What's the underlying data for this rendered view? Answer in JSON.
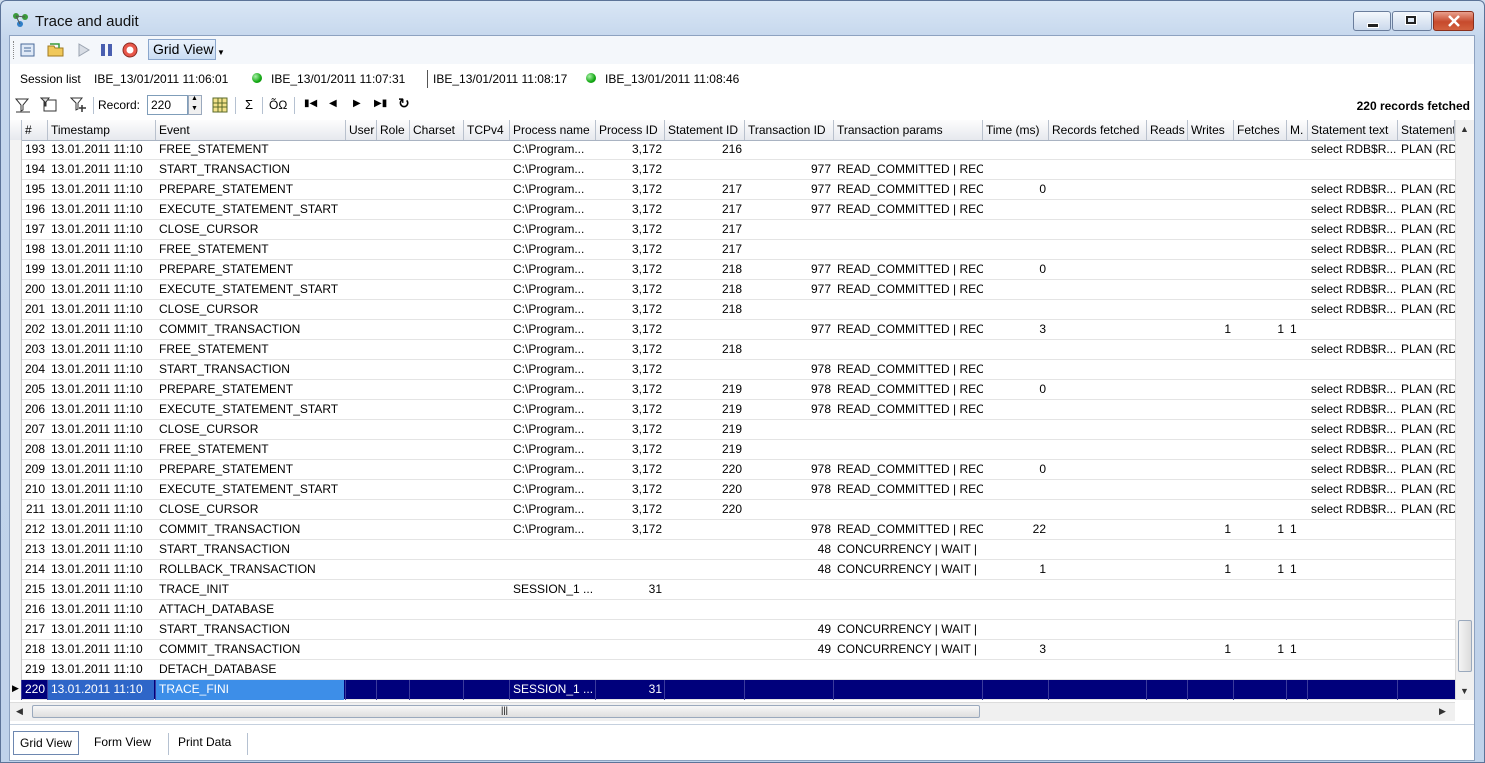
{
  "window": {
    "title": "Trace and audit"
  },
  "toolbar": {
    "view_label": "Grid View"
  },
  "session_bar": {
    "label": "Session list",
    "sessions": [
      "IBE_13/01/2011 11:06:01",
      "IBE_13/01/2011 11:07:31",
      "IBE_13/01/2011 11:08:17",
      "IBE_13/01/2011 11:08:46"
    ]
  },
  "nav": {
    "record_label": "Record:",
    "record_value": "220",
    "fetched": "220 records fetched",
    "sigma": "Σ",
    "oomega": "ÕΩ"
  },
  "grid": {
    "columns": [
      "#",
      "Timestamp",
      "Event",
      "User",
      "Role",
      "Charset",
      "TCPv4",
      "Process name",
      "Process ID",
      "Statement ID",
      "Transaction ID",
      "Transaction params",
      "Time (ms)",
      "Records fetched",
      "Reads",
      "Writes",
      "Fetches",
      "M.",
      "Statement text",
      "Statement"
    ],
    "rows": [
      [
        "193",
        "13.01.2011 11:10",
        "FREE_STATEMENT",
        "",
        "",
        "",
        "",
        "C:\\Program...",
        "3,172",
        "216",
        "",
        "",
        "",
        "",
        "",
        "",
        "",
        "",
        "select RDB$R...",
        "PLAN (RD"
      ],
      [
        "194",
        "13.01.2011 11:10",
        "START_TRANSACTION",
        "",
        "",
        "",
        "",
        "C:\\Program...",
        "3,172",
        "",
        "977",
        "READ_COMMITTED | REC",
        "",
        "",
        "",
        "",
        "",
        "",
        "",
        ""
      ],
      [
        "195",
        "13.01.2011 11:10",
        "PREPARE_STATEMENT",
        "",
        "",
        "",
        "",
        "C:\\Program...",
        "3,172",
        "217",
        "977",
        "READ_COMMITTED | REC",
        "0",
        "",
        "",
        "",
        "",
        "",
        "select RDB$R...",
        "PLAN (RD"
      ],
      [
        "196",
        "13.01.2011 11:10",
        "EXECUTE_STATEMENT_START",
        "",
        "",
        "",
        "",
        "C:\\Program...",
        "3,172",
        "217",
        "977",
        "READ_COMMITTED | REC",
        "",
        "",
        "",
        "",
        "",
        "",
        "select RDB$R...",
        "PLAN (RD"
      ],
      [
        "197",
        "13.01.2011 11:10",
        "CLOSE_CURSOR",
        "",
        "",
        "",
        "",
        "C:\\Program...",
        "3,172",
        "217",
        "",
        "",
        "",
        "",
        "",
        "",
        "",
        "",
        "select RDB$R...",
        "PLAN (RD"
      ],
      [
        "198",
        "13.01.2011 11:10",
        "FREE_STATEMENT",
        "",
        "",
        "",
        "",
        "C:\\Program...",
        "3,172",
        "217",
        "",
        "",
        "",
        "",
        "",
        "",
        "",
        "",
        "select RDB$R...",
        "PLAN (RD"
      ],
      [
        "199",
        "13.01.2011 11:10",
        "PREPARE_STATEMENT",
        "",
        "",
        "",
        "",
        "C:\\Program...",
        "3,172",
        "218",
        "977",
        "READ_COMMITTED | REC",
        "0",
        "",
        "",
        "",
        "",
        "",
        "select RDB$R...",
        "PLAN (RD"
      ],
      [
        "200",
        "13.01.2011 11:10",
        "EXECUTE_STATEMENT_START",
        "",
        "",
        "",
        "",
        "C:\\Program...",
        "3,172",
        "218",
        "977",
        "READ_COMMITTED | REC",
        "",
        "",
        "",
        "",
        "",
        "",
        "select RDB$R...",
        "PLAN (RD"
      ],
      [
        "201",
        "13.01.2011 11:10",
        "CLOSE_CURSOR",
        "",
        "",
        "",
        "",
        "C:\\Program...",
        "3,172",
        "218",
        "",
        "",
        "",
        "",
        "",
        "",
        "",
        "",
        "select RDB$R...",
        "PLAN (RD"
      ],
      [
        "202",
        "13.01.2011 11:10",
        "COMMIT_TRANSACTION",
        "",
        "",
        "",
        "",
        "C:\\Program...",
        "3,172",
        "",
        "977",
        "READ_COMMITTED | REC",
        "3",
        "",
        "",
        "1",
        "1",
        "1",
        "",
        ""
      ],
      [
        "203",
        "13.01.2011 11:10",
        "FREE_STATEMENT",
        "",
        "",
        "",
        "",
        "C:\\Program...",
        "3,172",
        "218",
        "",
        "",
        "",
        "",
        "",
        "",
        "",
        "",
        "select RDB$R...",
        "PLAN (RD"
      ],
      [
        "204",
        "13.01.2011 11:10",
        "START_TRANSACTION",
        "",
        "",
        "",
        "",
        "C:\\Program...",
        "3,172",
        "",
        "978",
        "READ_COMMITTED | REC",
        "",
        "",
        "",
        "",
        "",
        "",
        "",
        ""
      ],
      [
        "205",
        "13.01.2011 11:10",
        "PREPARE_STATEMENT",
        "",
        "",
        "",
        "",
        "C:\\Program...",
        "3,172",
        "219",
        "978",
        "READ_COMMITTED | REC",
        "0",
        "",
        "",
        "",
        "",
        "",
        "select RDB$R...",
        "PLAN (RD"
      ],
      [
        "206",
        "13.01.2011 11:10",
        "EXECUTE_STATEMENT_START",
        "",
        "",
        "",
        "",
        "C:\\Program...",
        "3,172",
        "219",
        "978",
        "READ_COMMITTED | REC",
        "",
        "",
        "",
        "",
        "",
        "",
        "select RDB$R...",
        "PLAN (RD"
      ],
      [
        "207",
        "13.01.2011 11:10",
        "CLOSE_CURSOR",
        "",
        "",
        "",
        "",
        "C:\\Program...",
        "3,172",
        "219",
        "",
        "",
        "",
        "",
        "",
        "",
        "",
        "",
        "select RDB$R...",
        "PLAN (RD"
      ],
      [
        "208",
        "13.01.2011 11:10",
        "FREE_STATEMENT",
        "",
        "",
        "",
        "",
        "C:\\Program...",
        "3,172",
        "219",
        "",
        "",
        "",
        "",
        "",
        "",
        "",
        "",
        "select RDB$R...",
        "PLAN (RD"
      ],
      [
        "209",
        "13.01.2011 11:10",
        "PREPARE_STATEMENT",
        "",
        "",
        "",
        "",
        "C:\\Program...",
        "3,172",
        "220",
        "978",
        "READ_COMMITTED | REC",
        "0",
        "",
        "",
        "",
        "",
        "",
        "select RDB$R...",
        "PLAN (RD"
      ],
      [
        "210",
        "13.01.2011 11:10",
        "EXECUTE_STATEMENT_START",
        "",
        "",
        "",
        "",
        "C:\\Program...",
        "3,172",
        "220",
        "978",
        "READ_COMMITTED | REC",
        "",
        "",
        "",
        "",
        "",
        "",
        "select RDB$R...",
        "PLAN (RD"
      ],
      [
        "211",
        "13.01.2011 11:10",
        "CLOSE_CURSOR",
        "",
        "",
        "",
        "",
        "C:\\Program...",
        "3,172",
        "220",
        "",
        "",
        "",
        "",
        "",
        "",
        "",
        "",
        "select RDB$R...",
        "PLAN (RD"
      ],
      [
        "212",
        "13.01.2011 11:10",
        "COMMIT_TRANSACTION",
        "",
        "",
        "",
        "",
        "C:\\Program...",
        "3,172",
        "",
        "978",
        "READ_COMMITTED | REC",
        "22",
        "",
        "",
        "1",
        "1",
        "1",
        "",
        ""
      ],
      [
        "213",
        "13.01.2011 11:10",
        "START_TRANSACTION",
        "",
        "",
        "",
        "",
        "",
        "",
        "",
        "48",
        "CONCURRENCY | WAIT |",
        "",
        "",
        "",
        "",
        "",
        "",
        "",
        ""
      ],
      [
        "214",
        "13.01.2011 11:10",
        "ROLLBACK_TRANSACTION",
        "",
        "",
        "",
        "",
        "",
        "",
        "",
        "48",
        "CONCURRENCY | WAIT |",
        "1",
        "",
        "",
        "1",
        "1",
        "1",
        "",
        ""
      ],
      [
        "215",
        "13.01.2011 11:10",
        "TRACE_INIT",
        "",
        "",
        "",
        "",
        "SESSION_1 ...",
        "31",
        "",
        "",
        "",
        "",
        "",
        "",
        "",
        "",
        "",
        "",
        ""
      ],
      [
        "216",
        "13.01.2011 11:10",
        "ATTACH_DATABASE",
        "",
        "",
        "",
        "",
        "",
        "",
        "",
        "",
        "",
        "",
        "",
        "",
        "",
        "",
        "",
        "",
        ""
      ],
      [
        "217",
        "13.01.2011 11:10",
        "START_TRANSACTION",
        "",
        "",
        "",
        "",
        "",
        "",
        "",
        "49",
        "CONCURRENCY | WAIT |",
        "",
        "",
        "",
        "",
        "",
        "",
        "",
        ""
      ],
      [
        "218",
        "13.01.2011 11:10",
        "COMMIT_TRANSACTION",
        "",
        "",
        "",
        "",
        "",
        "",
        "",
        "49",
        "CONCURRENCY | WAIT |",
        "3",
        "",
        "",
        "1",
        "1",
        "1",
        "",
        ""
      ],
      [
        "219",
        "13.01.2011 11:10",
        "DETACH_DATABASE",
        "",
        "",
        "",
        "",
        "",
        "",
        "",
        "",
        "",
        "",
        "",
        "",
        "",
        "",
        "",
        "",
        ""
      ],
      [
        "220",
        "13.01.2011 11:10",
        "TRACE_FINI",
        "",
        "",
        "",
        "",
        "SESSION_1 ...",
        "31",
        "",
        "",
        "",
        "",
        "",
        "",
        "",
        "",
        "",
        "",
        ""
      ]
    ],
    "selected_row": 27
  },
  "tabs": [
    "Grid View",
    "Form View",
    "Print Data"
  ]
}
